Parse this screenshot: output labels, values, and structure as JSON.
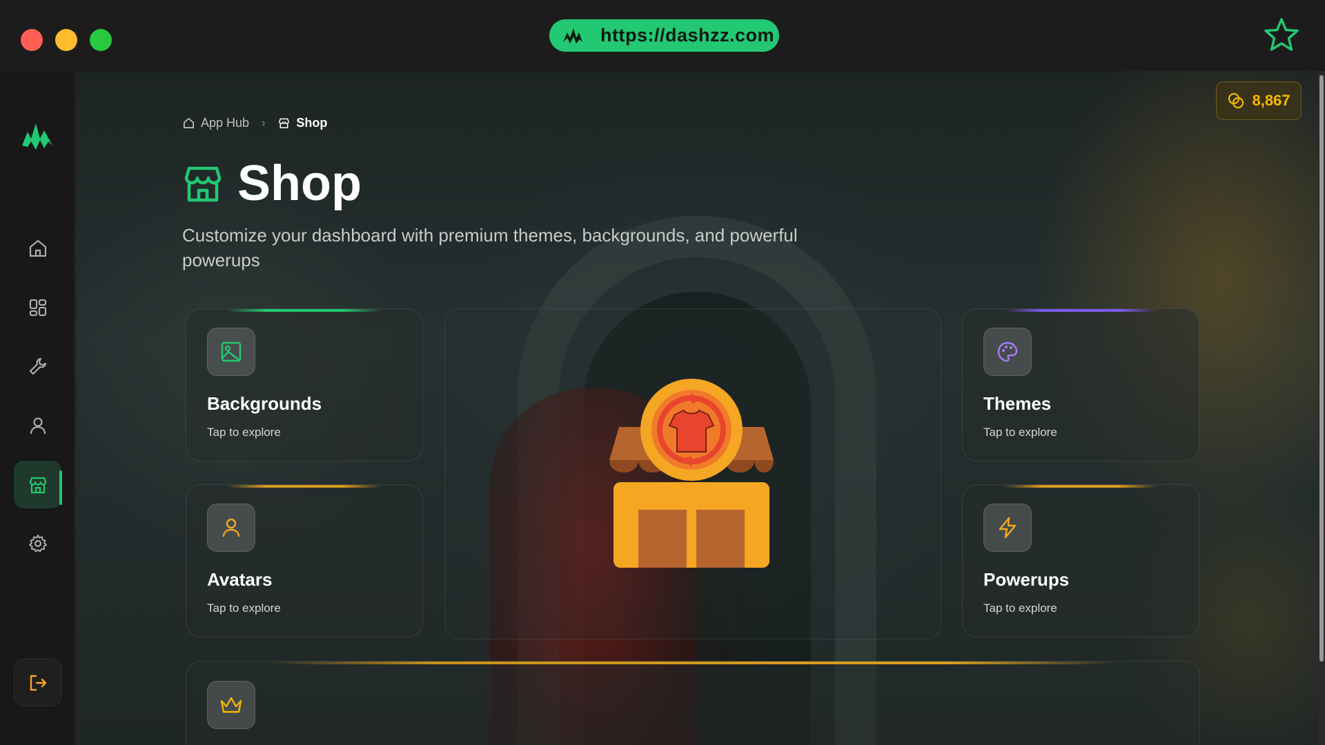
{
  "browser": {
    "url": "https://dashzz.com"
  },
  "breadcrumb": {
    "home": "App Hub",
    "current": "Shop"
  },
  "page": {
    "title": "Shop",
    "subtitle": "Customize your dashboard with premium themes, backgrounds, and powerful powerups"
  },
  "coins": {
    "balance": "8,867"
  },
  "sidebar": {
    "items": [
      {
        "icon": "home-icon"
      },
      {
        "icon": "dashboard-icon"
      },
      {
        "icon": "wrench-icon"
      },
      {
        "icon": "user-icon"
      },
      {
        "icon": "shop-icon",
        "active": true
      },
      {
        "icon": "gear-icon"
      }
    ],
    "logout_icon": "logout-icon"
  },
  "cards": [
    {
      "label": "Backgrounds",
      "sub": "Tap to explore",
      "icon": "image-icon",
      "accent": "#22c872"
    },
    {
      "label": "Themes",
      "sub": "Tap to explore",
      "icon": "palette-icon",
      "accent": "#7c5cf0"
    },
    {
      "label": "Avatars",
      "sub": "Tap to explore",
      "icon": "user-icon",
      "accent": "#d99a1e"
    },
    {
      "label": "Powerups",
      "sub": "Tap to explore",
      "icon": "bolt-icon",
      "accent": "#d99a1e"
    }
  ],
  "bottom_card": {
    "icon": "crown-icon",
    "accent": "#d9a21e"
  },
  "colors": {
    "brand": "#22c872",
    "coin": "#f5b800",
    "purple": "#a97cf5",
    "amber": "#f5a623"
  }
}
